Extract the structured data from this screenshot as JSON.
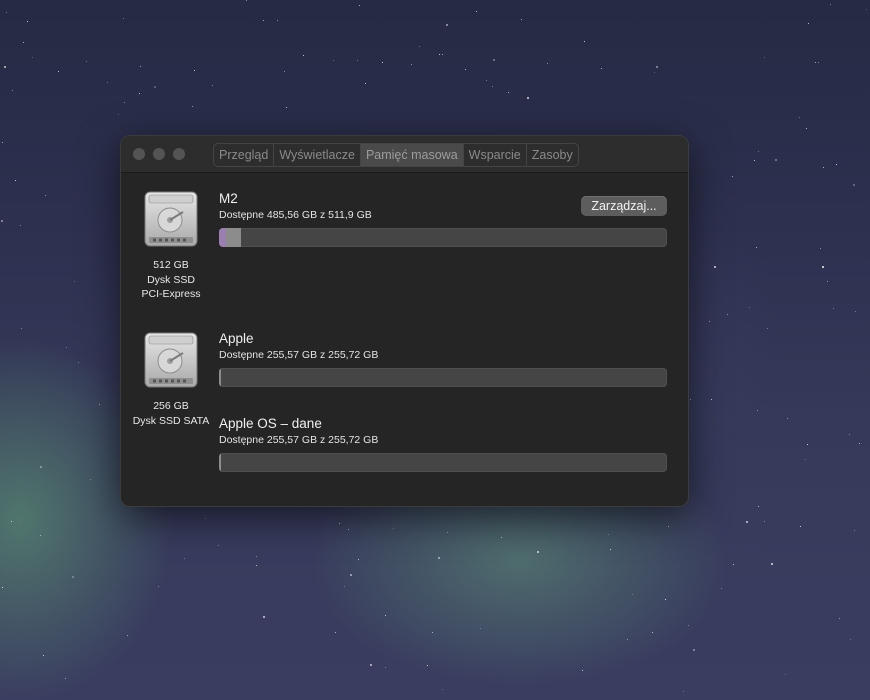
{
  "window": {
    "tabs": [
      {
        "label": "Przegląd"
      },
      {
        "label": "Wyświetlacze"
      },
      {
        "label": "Pamięć masowa",
        "active": true
      },
      {
        "label": "Wsparcie"
      },
      {
        "label": "Zasoby"
      }
    ]
  },
  "disks": [
    {
      "icon": "hard-drive-icon",
      "caption": [
        "512 GB",
        "Dysk SSD",
        "PCI-Express"
      ],
      "volumes": [
        {
          "name": "M2",
          "available": "Dostępne 485,56 GB z 511,9 GB",
          "used_fraction": 0.05,
          "manage_label": "Zarządzaj..."
        }
      ]
    },
    {
      "icon": "hard-drive-icon",
      "caption": [
        "256 GB",
        "Dysk SSD SATA"
      ],
      "volumes": [
        {
          "name": "Apple",
          "available": "Dostępne 255,57 GB z 255,72 GB",
          "used_fraction": 0.003
        },
        {
          "name": "Apple OS – dane",
          "available": "Dostępne 255,57 GB z 255,72 GB",
          "used_fraction": 0.003
        }
      ]
    }
  ],
  "colors": {
    "bar_track": "#454545",
    "segment_purple": "#9b7fb0",
    "segment_gray": "#8c8c8c"
  }
}
